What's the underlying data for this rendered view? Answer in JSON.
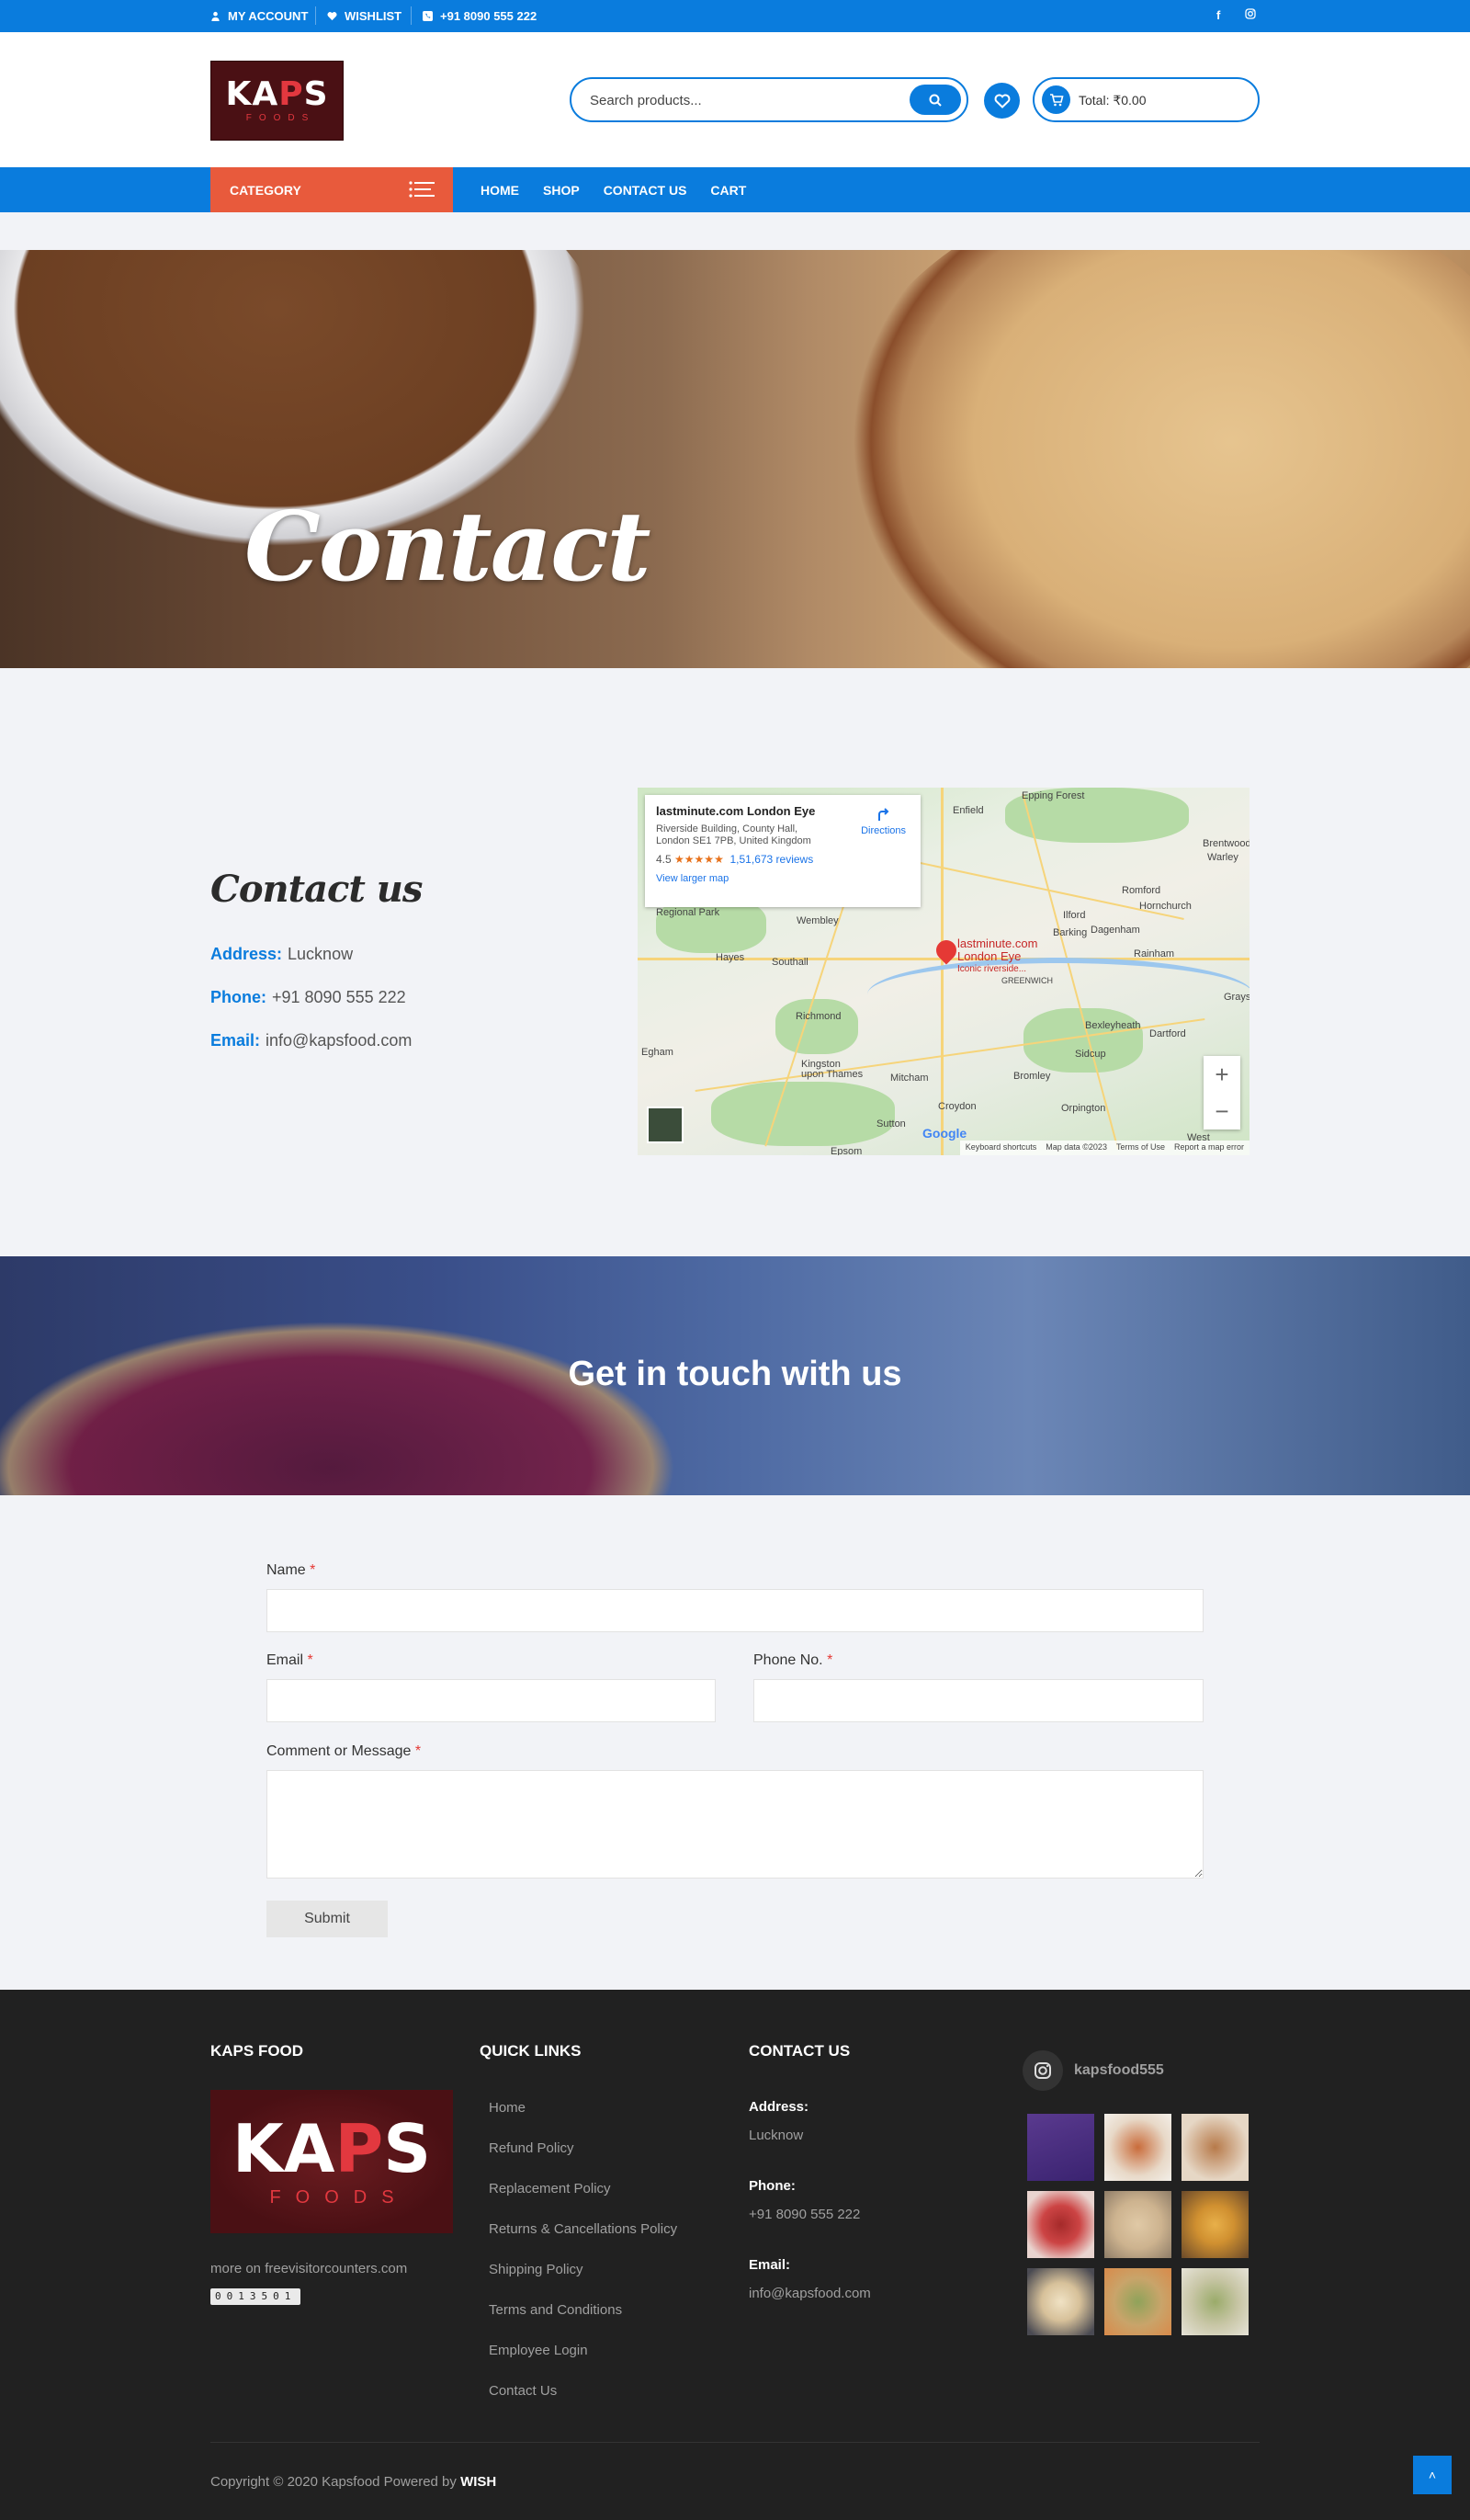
{
  "topbar": {
    "my_account": "MY ACCOUNT",
    "wishlist": "WISHLIST",
    "phone": "+91 8090 555 222",
    "social_facebook": "f"
  },
  "header": {
    "logo_text_a": "KA",
    "logo_text_r": "P",
    "logo_text_b": "S",
    "logo_sub": "FOODS",
    "search_placeholder": "Search products...",
    "cart_total": "Total: ₹0.00"
  },
  "nav": {
    "category": "CATEGORY",
    "links": [
      "HOME",
      "SHOP",
      "CONTACT US",
      "CART"
    ]
  },
  "hero": {
    "title": "Contact"
  },
  "contact": {
    "title": "Contact us",
    "address_label": "Address:",
    "address": "Lucknow",
    "phone_label": "Phone:",
    "phone": "+91 8090 555 222",
    "email_label": "Email:",
    "email": "info@kapsfood.com"
  },
  "map": {
    "place_name": "lastminute.com London Eye",
    "address": "Riverside Building, County Hall, London SE1 7PB, United Kingdom",
    "rating": "4.5",
    "stars": "★★★★★",
    "reviews": "1,51,673 reviews",
    "directions": "Directions",
    "view_larger": "View larger map",
    "pin_label_1": "lastminute.com",
    "pin_label_2": "London Eye",
    "pin_label_3": "Iconic riverside...",
    "place_labels": [
      "Epping Forest",
      "Enfield",
      "Brentwood",
      "Warley",
      "Romford",
      "Hornchurch",
      "Ilford",
      "Barking",
      "Dagenham",
      "Regional Park",
      "Wembley",
      "Hayes",
      "Southall",
      "GREENWICH",
      "Rainham",
      "Richmond",
      "Bexleyheath",
      "Dartford",
      "Egham",
      "Sidcup",
      "Kingston upon Thames",
      "Mitcham",
      "Bromley",
      "Croydon",
      "Orpington",
      "Sutton",
      "Epsom",
      "West",
      "Grays"
    ],
    "zoom_in": "+",
    "zoom_out": "−",
    "attrib": [
      "Keyboard shortcuts",
      "Map data ©2023",
      "Terms of Use",
      "Report a map error"
    ],
    "google": "Google"
  },
  "touch": {
    "heading": "Get in touch with us"
  },
  "form": {
    "name_label": "Name",
    "email_label": "Email",
    "phone_label": "Phone No.",
    "message_label": "Comment or Message",
    "required_mark": "*",
    "submit": "Submit"
  },
  "footer": {
    "col1_title": "KAPS FOOD",
    "col2_title": "QUICK LINKS",
    "col3_title": "CONTACT US",
    "logo_text_a": "KA",
    "logo_text_r": "P",
    "logo_text_b": "S",
    "logo_sub": "FOODS",
    "counter_label": "more on freevisitorcounters.com",
    "counter": "0013501",
    "links": [
      "Home",
      "Refund Policy",
      "Replacement Policy",
      "Returns & Cancellations Policy",
      "Shipping Policy",
      "Terms and Conditions",
      "Employee Login",
      "Contact Us"
    ],
    "address_label": "Address:",
    "address": "Lucknow",
    "phone_label": "Phone:",
    "phone": "+91 8090 555 222",
    "email_label": "Email:",
    "email": "info@kapsfood.com",
    "instagram_handle": "kapsfood555",
    "copyright_prefix": "Copyright © 2020 Kapsfood Powered by",
    "copyright_brand": "WISH",
    "to_top": "˄"
  },
  "colors": {
    "primary": "#0a7cdd",
    "category": "#e85a3c",
    "footer_bg": "#212121",
    "required": "#e53935"
  },
  "icons": [
    "user-icon",
    "heart-icon",
    "phone-icon",
    "facebook-icon",
    "instagram-icon",
    "search-icon",
    "cart-icon",
    "menu-icon",
    "map-pin-icon",
    "directions-icon",
    "arrow-up-icon"
  ]
}
